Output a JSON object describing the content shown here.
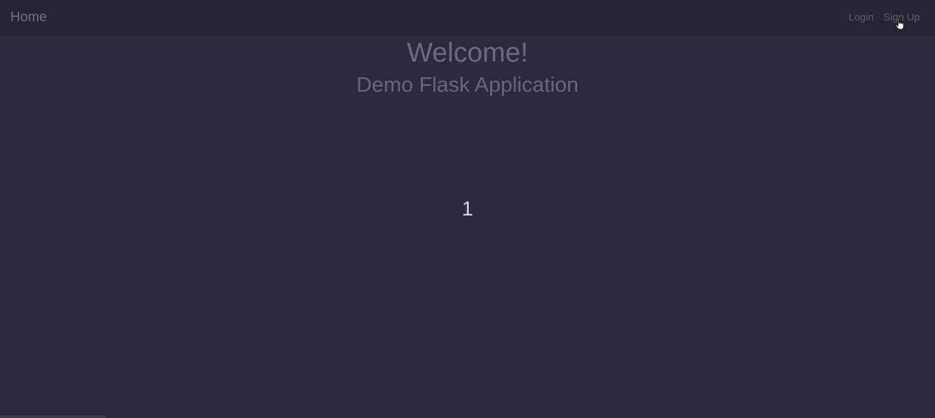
{
  "navbar": {
    "brand": "Home",
    "links": [
      {
        "label": "Login"
      },
      {
        "label": "Sign Up"
      }
    ]
  },
  "hero": {
    "title": "Welcome!",
    "subtitle": "Demo Flask Application"
  },
  "counter": {
    "value": "1"
  },
  "cursor": {
    "icon": "hand-pointer-icon"
  },
  "colors": {
    "background": "#2b2b40",
    "navbar": "#252533",
    "counter_text": "#d6d6e0"
  }
}
